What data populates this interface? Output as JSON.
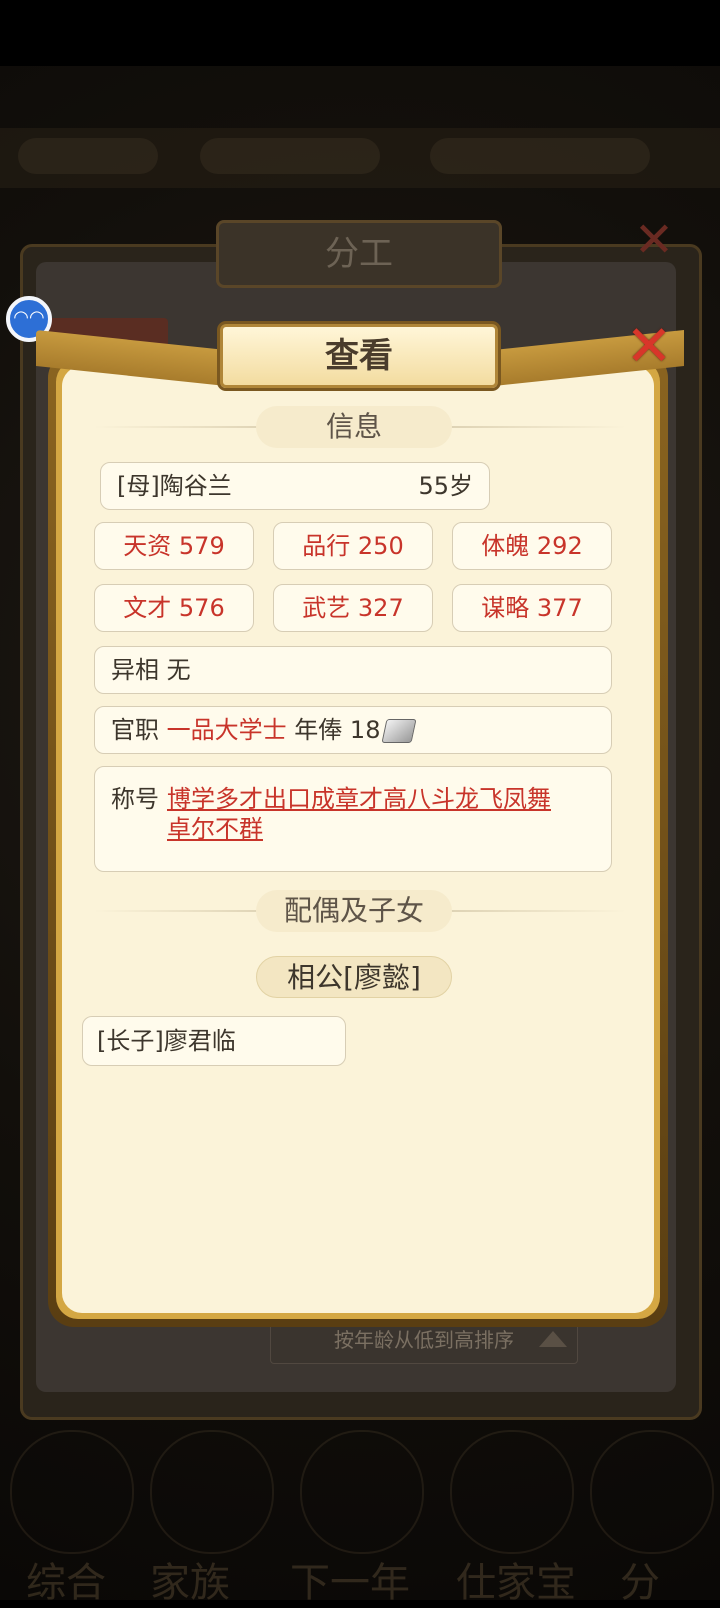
{
  "background": {
    "tabs": [
      "综合",
      "家族",
      "下一年",
      "仕家宝",
      "分"
    ]
  },
  "under_panel": {
    "title": "分工",
    "sort_label": "按年龄从低到高排序"
  },
  "dialog": {
    "title": "查看",
    "info_section": "信息",
    "member": {
      "name": "[母]陶谷兰",
      "age": "55岁"
    },
    "stats": [
      {
        "label": "天资 579"
      },
      {
        "label": "品行 250"
      },
      {
        "label": "体魄 292"
      },
      {
        "label": "文才 576"
      },
      {
        "label": "武艺 327"
      },
      {
        "label": "谋略 377"
      }
    ],
    "trait": {
      "label": "异相",
      "value": "无"
    },
    "office": {
      "label": "官职",
      "value": "一品大学士",
      "salary_label": "年俸",
      "salary": "18"
    },
    "titles": {
      "label": "称号",
      "line1": "博学多才出口成章才高八斗龙飞凤舞",
      "line2": "卓尔不群"
    },
    "family_section": "配偶及子女",
    "spouse": "相公[廖懿]",
    "children": [
      {
        "name": "[长子]廖君临"
      }
    ]
  },
  "icons": {
    "close": "close-x-icon",
    "silver": "silver-ingot-icon",
    "float": "float-assistant-icon"
  },
  "colors": {
    "accent_red": "#c8342a",
    "paper": "#fbf3d9",
    "gold": "#d4a743"
  }
}
